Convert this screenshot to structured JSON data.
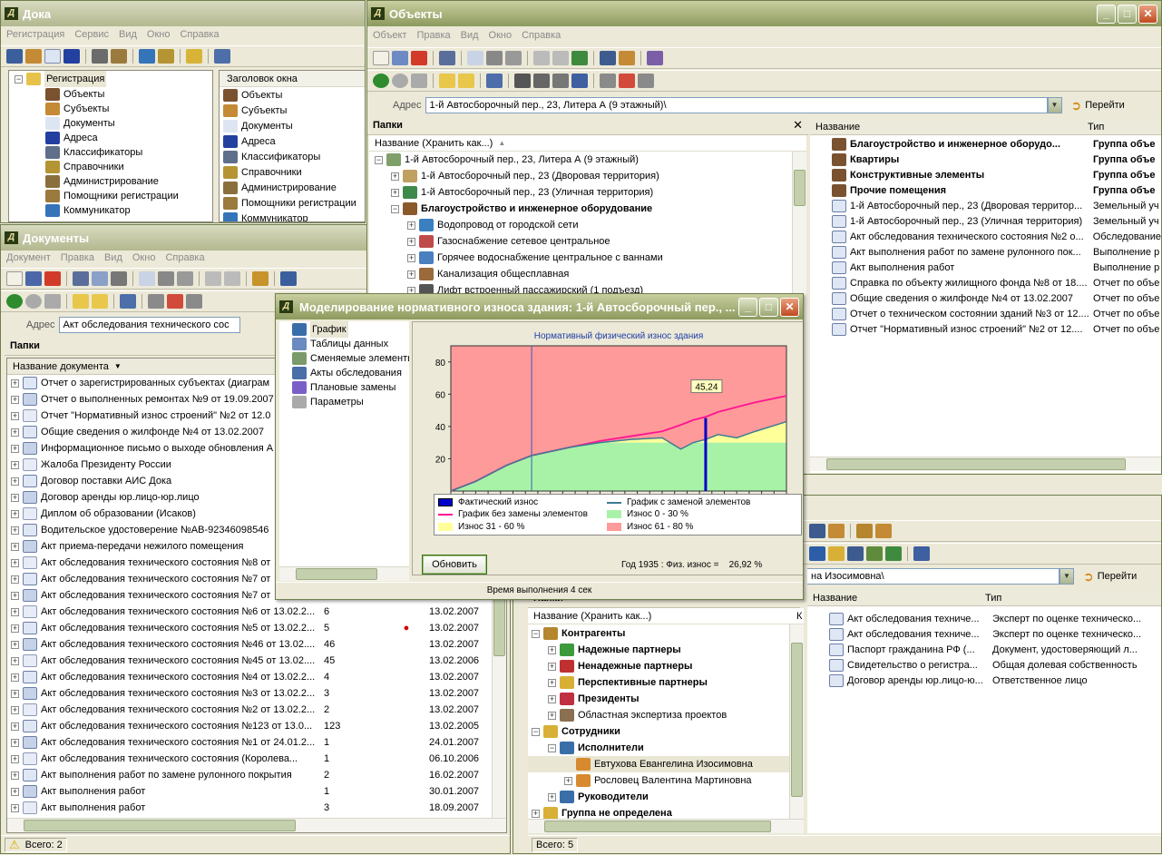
{
  "doka": {
    "title": "Дока",
    "menu": [
      "Регистрация",
      "Сервис",
      "Вид",
      "Окно",
      "Справка"
    ],
    "tree_root": "Регистрация",
    "tree_items": [
      "Объекты",
      "Субъекты",
      "Документы",
      "Адреса",
      "Классификаторы",
      "Справочники",
      "Администрирование",
      "Помощники регистрации",
      "Коммуникатор"
    ],
    "list_header": "Заголовок окна",
    "list_items": [
      "Объекты",
      "Субъекты",
      "Документы",
      "Адреса",
      "Классификаторы",
      "Справочники",
      "Администрирование",
      "Помощники регистрации",
      "Коммуникатор"
    ]
  },
  "documents": {
    "title": "Документы",
    "menu": [
      "Документ",
      "Правка",
      "Вид",
      "Окно",
      "Справка"
    ],
    "address_label": "Адрес",
    "address_value": "Акт обследования технического сос",
    "folders_title": "Папки",
    "column_name": "Название документа",
    "rows": [
      {
        "name": "Отчет о зарегистрированных субъектах (диаграм",
        "num": "",
        "date": "",
        "alert": false
      },
      {
        "name": "Отчет о выполненных ремонтах №9 от 19.09.2007",
        "num": "",
        "date": "",
        "alert": false
      },
      {
        "name": "Отчет \"Нормативный износ строений\" №2 от 12.0",
        "num": "",
        "date": "",
        "alert": false
      },
      {
        "name": "Общие сведения о жилфонде №4 от 13.02.2007",
        "num": "",
        "date": "",
        "alert": false
      },
      {
        "name": "Информационное письмо о выходе обновления А",
        "num": "",
        "date": "",
        "alert": false
      },
      {
        "name": "Жалоба Президенту России",
        "num": "",
        "date": "",
        "alert": false
      },
      {
        "name": "Договор поставки АИС Дока",
        "num": "",
        "date": "",
        "alert": false
      },
      {
        "name": "Договор аренды юр.лицо-юр.лицо",
        "num": "",
        "date": "",
        "alert": false
      },
      {
        "name": "Диплом об образовании (Исаков)",
        "num": "",
        "date": "",
        "alert": false
      },
      {
        "name": "Водительское удостоверение №AB-92346098546",
        "num": "",
        "date": "",
        "alert": false
      },
      {
        "name": "Акт приема-передачи нежилого помещения",
        "num": "",
        "date": "",
        "alert": false
      },
      {
        "name": "Акт обследования технического состояния №8 от",
        "num": "",
        "date": "",
        "alert": false
      },
      {
        "name": "Акт обследования технического состояния №7 от",
        "num": "",
        "date": "",
        "alert": false
      },
      {
        "name": "Акт обследования технического состояния №7 от",
        "num": "",
        "date": "",
        "alert": false
      },
      {
        "name": "Акт обследования технического состояния №6 от 13.02.2...",
        "num": "6",
        "date": "13.02.2007",
        "alert": false
      },
      {
        "name": "Акт обследования технического состояния №5 от 13.02.2...",
        "num": "5",
        "date": "13.02.2007",
        "alert": true
      },
      {
        "name": "Акт обследования технического состояния №46 от 13.02....",
        "num": "46",
        "date": "13.02.2007",
        "alert": false
      },
      {
        "name": "Акт обследования технического состояния №45 от 13.02....",
        "num": "45",
        "date": "13.02.2006",
        "alert": false
      },
      {
        "name": "Акт обследования технического состояния №4 от 13.02.2...",
        "num": "4",
        "date": "13.02.2007",
        "alert": false
      },
      {
        "name": "Акт обследования технического состояния №3 от 13.02.2...",
        "num": "3",
        "date": "13.02.2007",
        "alert": false
      },
      {
        "name": "Акт обследования технического состояния №2 от 13.02.2...",
        "num": "2",
        "date": "13.02.2007",
        "alert": false
      },
      {
        "name": "Акт обследования технического состояния №123 от 13.0...",
        "num": "123",
        "date": "13.02.2005",
        "alert": false
      },
      {
        "name": "Акт обследования технического состояния №1 от 24.01.2...",
        "num": "1",
        "date": "24.01.2007",
        "alert": false
      },
      {
        "name": "Акт обследования технического состояния (Королева...",
        "num": "1",
        "date": "06.10.2006",
        "alert": false
      },
      {
        "name": "Акт выполнения работ по замене рулонного покрытия",
        "num": "2",
        "date": "16.02.2007",
        "alert": false
      },
      {
        "name": "Акт выполнения работ",
        "num": "1",
        "date": "30.01.2007",
        "alert": false
      },
      {
        "name": "Акт выполнения работ",
        "num": "3",
        "date": "18.09.2007",
        "alert": false
      }
    ],
    "status": "Всего: 2"
  },
  "objects": {
    "title": "Объекты",
    "menu": [
      "Объект",
      "Правка",
      "Вид",
      "Окно",
      "Справка"
    ],
    "address_label": "Адрес",
    "address_value": "1-й Автосборочный пер., 23, Литера А (9 этажный)\\",
    "go_label": "Перейти",
    "folders_title": "Папки",
    "folders_column": "Название (Хранить как...)",
    "tree": [
      {
        "label": "1-й Автосборочный пер., 23, Литера А (9 этажный)",
        "level": 0,
        "exp": "-",
        "bold": false
      },
      {
        "label": "1-й Автосборочный пер., 23 (Дворовая территория)",
        "level": 1,
        "exp": "+",
        "bold": false
      },
      {
        "label": "1-й Автосборочный пер., 23 (Уличная территория)",
        "level": 1,
        "exp": "+",
        "bold": false
      },
      {
        "label": "Благоустройство и инженерное оборудование",
        "level": 1,
        "exp": "-",
        "bold": true
      },
      {
        "label": "Водопровод от городской сети",
        "level": 2,
        "exp": "+",
        "bold": false
      },
      {
        "label": "Газоснабжение сетевое центральное",
        "level": 2,
        "exp": "+",
        "bold": false
      },
      {
        "label": "Горячее водоснабжение центральное с ваннами",
        "level": 2,
        "exp": "+",
        "bold": false
      },
      {
        "label": "Канализация общесплавная",
        "level": 2,
        "exp": "+",
        "bold": false
      },
      {
        "label": "Лифт встроенный пассажирский (1 подъезд)",
        "level": 2,
        "exp": "+",
        "bold": false
      }
    ],
    "list_columns": [
      "Название",
      "Тип"
    ],
    "list": [
      {
        "name": "Благоустройство и инженерное оборудо...",
        "type": "Группа объе",
        "bold": true
      },
      {
        "name": "Квартиры",
        "type": "Группа объе",
        "bold": true
      },
      {
        "name": "Конструктивные элементы",
        "type": "Группа объе",
        "bold": true
      },
      {
        "name": "Прочие помещения",
        "type": "Группа объе",
        "bold": true
      },
      {
        "name": "1-й Автосборочный пер., 23 (Дворовая территор...",
        "type": "Земельный уч",
        "bold": false
      },
      {
        "name": "1-й Автосборочный пер., 23 (Уличная территория)",
        "type": "Земельный уч",
        "bold": false
      },
      {
        "name": "Акт обследования технического состояния №2 о...",
        "type": "Обследование",
        "bold": false
      },
      {
        "name": "Акт выполнения работ по замене рулонного пок...",
        "type": "Выполнение р",
        "bold": false
      },
      {
        "name": "Акт выполнения работ",
        "type": "Выполнение р",
        "bold": false
      },
      {
        "name": "Справка по объекту жилищного фонда №8 от 18....",
        "type": "Отчет по объе",
        "bold": false
      },
      {
        "name": "Общие сведения о жилфонде №4 от 13.02.2007",
        "type": "Отчет по объе",
        "bold": false
      },
      {
        "name": "Отчет о техническом состоянии зданий №3 от 12....",
        "type": "Отчет по объе",
        "bold": false
      },
      {
        "name": "Отчет \"Нормативный износ строений\" №2 от 12....",
        "type": "Отчет по объе",
        "bold": false
      }
    ]
  },
  "subjects": {
    "address_value": "на Изосимовна\\",
    "go_label": "Перейти",
    "folders_title": "Папки",
    "folders_column": "Название (Хранить как...)",
    "folders_column2": "К",
    "tree": [
      {
        "label": "Контрагенты",
        "level": 0,
        "exp": "-",
        "bold": true
      },
      {
        "label": "Надежные партнеры",
        "level": 1,
        "exp": "+",
        "bold": true
      },
      {
        "label": "Ненадежные партнеры",
        "level": 1,
        "exp": "+",
        "bold": true
      },
      {
        "label": "Перспективные партнеры",
        "level": 1,
        "exp": "+",
        "bold": true
      },
      {
        "label": "Президенты",
        "level": 1,
        "exp": "+",
        "bold": true
      },
      {
        "label": "Областная экспертиза проектов",
        "level": 1,
        "exp": "+",
        "bold": false
      },
      {
        "label": "Сотрудники",
        "level": 0,
        "exp": "-",
        "bold": true
      },
      {
        "label": "Исполнители",
        "level": 1,
        "exp": "-",
        "bold": true
      },
      {
        "label": "Евтухова Евангелина Изосимовна",
        "level": 2,
        "exp": "",
        "bold": false
      },
      {
        "label": "Рословец Валентина Мартиновна",
        "level": 2,
        "exp": "+",
        "bold": false
      },
      {
        "label": "Руководители",
        "level": 1,
        "exp": "+",
        "bold": true
      },
      {
        "label": "Группа не определена",
        "level": 0,
        "exp": "+",
        "bold": true
      }
    ],
    "list_columns": [
      "Название",
      "Тип"
    ],
    "list": [
      {
        "name": "Акт обследования техниче...",
        "type": "Эксперт по оценке техническо..."
      },
      {
        "name": "Акт обследования техниче...",
        "type": "Эксперт по оценке техническо..."
      },
      {
        "name": "Паспорт гражданина РФ (...",
        "type": "Документ, удостоверяющий л..."
      },
      {
        "name": "Свидетельство о регистра...",
        "type": "Общая долевая собственность"
      },
      {
        "name": "Договор аренды юр.лицо-ю...",
        "type": "Ответственное лицо"
      }
    ],
    "status": "Всего: 5"
  },
  "modal": {
    "title": "Моделирование нормативного износа здания: 1-й Автосборочный пер., ...",
    "nav": [
      "График",
      "Таблицы данных",
      "Сменяемые элементы",
      "Акты обследования",
      "Плановые замены",
      "Параметры"
    ],
    "refresh_label": "Обновить",
    "info": "Год 1935 : Физ. износ =    26,92 %",
    "exec_time": "Время выполнения 4 сек",
    "colors": {
      "zone80": "#FF9A9A",
      "zone60": "#FFFF9A",
      "zone30": "#A8F2A8",
      "line_no_replace": "#FF1493",
      "line_replace": "#3C7C94",
      "actual": "#0000CC"
    }
  },
  "chart_data": {
    "type": "area",
    "title": "Нормативный физический износ здания",
    "xlabel": "",
    "ylabel": "",
    "xlim": [
      1966,
      2020
    ],
    "ylim": [
      0,
      90
    ],
    "x_ticks": [
      "1970",
      "1980",
      "1990",
      "2000",
      "2010"
    ],
    "y_ticks": [
      "20",
      "40",
      "60",
      "80"
    ],
    "x": [
      1966,
      1970,
      1975,
      1979,
      1985,
      1990,
      1995,
      2000,
      2003,
      2005,
      2007,
      2009,
      2012,
      2015,
      2020
    ],
    "series": [
      {
        "name": "График без замены элементов",
        "values": [
          0,
          6,
          16,
          22,
          27,
          31,
          34,
          37,
          41,
          44,
          46,
          49,
          52,
          55,
          59
        ]
      },
      {
        "name": "График с заменой элементов",
        "values": [
          0,
          6,
          16,
          22,
          27,
          30,
          32,
          33,
          26,
          30,
          32,
          35,
          33,
          37,
          43
        ]
      }
    ],
    "bands": [
      {
        "name": "Износ 0 - 30 %",
        "from": 0,
        "to": 30
      },
      {
        "name": "Износ 31 - 60 %",
        "from": 30,
        "to": 60
      },
      {
        "name": "Износ 61 - 80 %",
        "from": 60,
        "to": 90
      }
    ],
    "actual": {
      "name": "Фактический износ",
      "x": 2007,
      "value": 45.24,
      "label": "45,24"
    },
    "marker_year": 1979,
    "legend_position": "bottom"
  }
}
